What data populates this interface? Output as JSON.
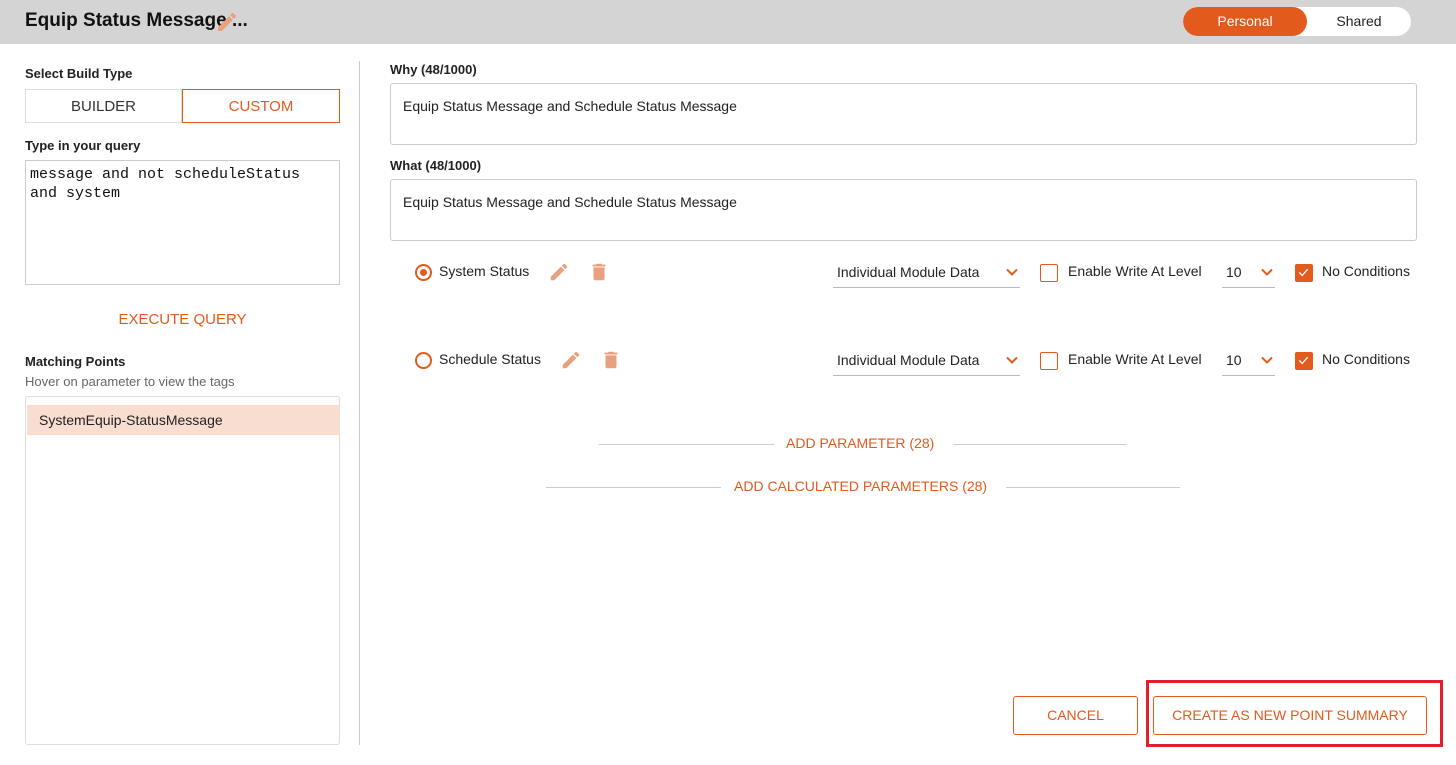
{
  "header": {
    "title": "Equip Status Message ...",
    "toggle": {
      "personal": "Personal",
      "shared": "Shared",
      "selected": "Personal"
    }
  },
  "left_panel": {
    "build_type_label": "Select Build Type",
    "builder_label": "BUILDER",
    "custom_label": "CUSTOM",
    "query_label": "Type in your query",
    "query_value": "message and not scheduleStatus\nand system",
    "execute_label": "EXECUTE QUERY",
    "matching_label": "Matching Points",
    "matching_hint": "Hover on parameter to view the tags",
    "matching_items": [
      "SystemEquip-StatusMessage"
    ]
  },
  "main": {
    "why_label": "Why (48/1000)",
    "why_value": "Equip Status Message and Schedule Status Message",
    "what_label": "What (48/1000)",
    "what_value": "Equip Status Message and Schedule Status Message",
    "params": [
      {
        "name": "System Status",
        "selected": true,
        "data_type": "Individual Module Data",
        "write_label": "Enable Write At Level",
        "write_enabled": false,
        "level": "10",
        "no_conditions_label": "No Conditions",
        "no_conditions": true
      },
      {
        "name": "Schedule Status",
        "selected": false,
        "data_type": "Individual Module Data",
        "write_label": "Enable Write At Level",
        "write_enabled": false,
        "level": "10",
        "no_conditions_label": "No Conditions",
        "no_conditions": true
      }
    ],
    "add_parameter_label": "ADD PARAMETER (28)",
    "add_calculated_label": "ADD CALCULATED PARAMETERS (28)"
  },
  "footer": {
    "cancel_label": "CANCEL",
    "create_label": "CREATE AS NEW POINT SUMMARY"
  },
  "colors": {
    "accent": "#e25a1c",
    "highlight": "#e0202b",
    "topbar": "#d4d4d4",
    "selected_row": "#f9ddd0"
  }
}
